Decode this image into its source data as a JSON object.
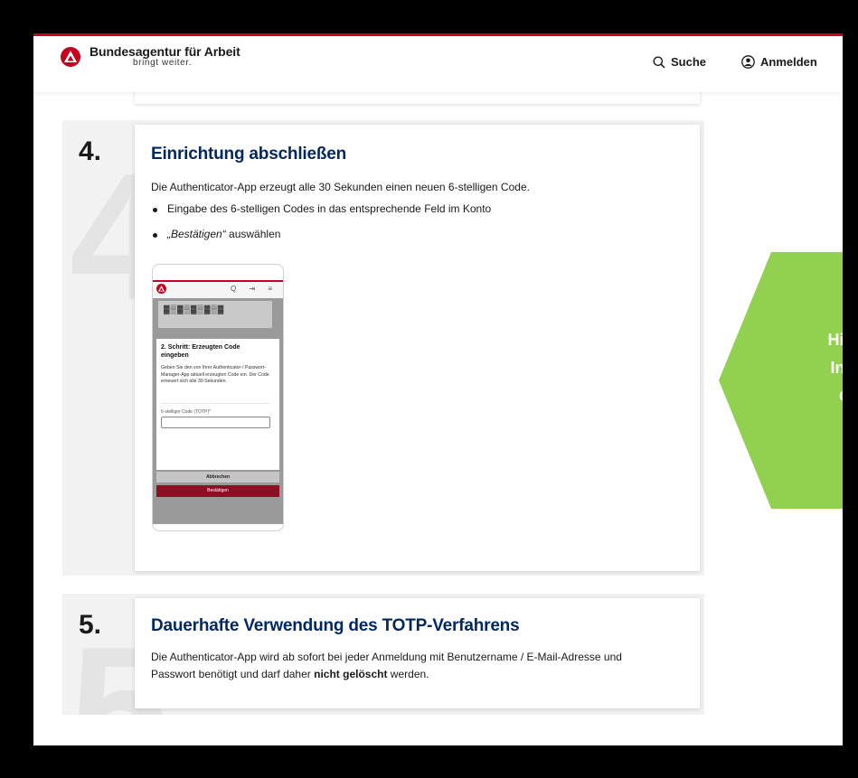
{
  "header": {
    "brand_name": "Bundesagentur für Arbeit",
    "brand_slogan": "bringt weiter.",
    "search_label": "Suche",
    "login_label": "Anmelden"
  },
  "colors": {
    "brand_red": "#c8001e",
    "title_blue": "#00285f",
    "hint_green": "#92d050",
    "confirm_red": "#8a1024"
  },
  "steps": [
    {
      "number": "4.",
      "bg_number": "4",
      "title": "Einrichtung abschließen",
      "text": "Die Authenticator-App erzeugt alle 30 Sekunden einen neuen 6-stelligen Code.",
      "bullets": [
        {
          "text": "Eingabe des 6-stelligen Codes in das entsprechende Feld im Konto"
        },
        {
          "em": "„Bestätigen“",
          "text": " auswählen"
        }
      ],
      "phone": {
        "icons": "Q ⇥ ≡",
        "qr_glyph": "▓▒▓▒▓▒▓▒▓",
        "modal_title": "2. Schritt: Erzeugten Code eingeben",
        "modal_text": "Geben Sie den von Ihrer Authenticator-/ Passwort-Manager-App aktuell erzeugten Code ein. Der Code erneuert sich alle 30 Sekunden.",
        "field_label": "6-stelliger Code (TOTP)*",
        "cancel_label": "Abbrechen",
        "confirm_label": "Bestätigen"
      }
    },
    {
      "number": "5.",
      "bg_number": "5",
      "title": "Dauerhafte Verwendung des TOTP-Verfahrens",
      "text_line1": "Die Authenticator-App wird ab sofort bei jeder Anmeldung mit Benutzername / E-Mail-Adresse und",
      "text_line2_pre": "Passwort benötigt und darf daher ",
      "text_line2_bold": "nicht gelöscht",
      "text_line2_post": " werden."
    }
  ],
  "hint": {
    "text": "Hinwe\nInstal\nder"
  }
}
